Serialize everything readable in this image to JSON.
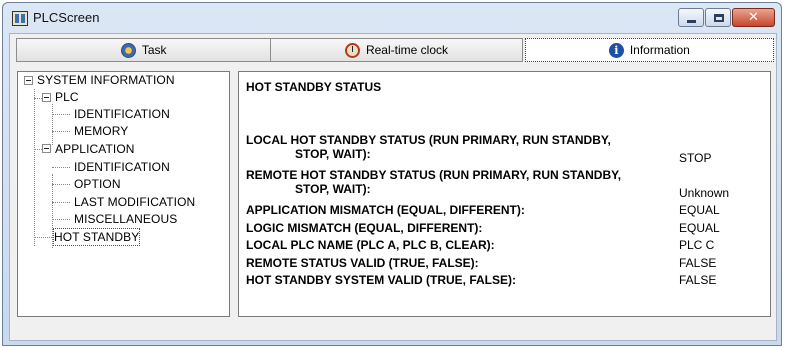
{
  "window": {
    "title": "PLCScreen",
    "close_glyph": "✕"
  },
  "tabs": [
    {
      "label": "Task",
      "icon": "task-icon"
    },
    {
      "label": "Real-time clock",
      "icon": "clock-icon"
    },
    {
      "label": "Information",
      "icon": "info-icon",
      "selected": true
    }
  ],
  "tree": {
    "root": "SYSTEM INFORMATION",
    "plc": "PLC",
    "plc_identification": "IDENTIFICATION",
    "plc_memory": "MEMORY",
    "application": "APPLICATION",
    "app_identification": "IDENTIFICATION",
    "app_option": "OPTION",
    "app_last_modification": "LAST MODIFICATION",
    "app_miscellaneous": "MISCELLANEOUS",
    "hot_standby": "HOT STANDBY"
  },
  "detail": {
    "heading": "HOT STANDBY STATUS",
    "rows": [
      {
        "label": "LOCAL HOT STANDBY STATUS (RUN PRIMARY, RUN STANDBY,",
        "cont": "STOP, WAIT):",
        "value": "STOP"
      },
      {
        "label": "REMOTE HOT STANDBY STATUS (RUN PRIMARY, RUN STANDBY,",
        "cont": "STOP, WAIT):",
        "value": "Unknown"
      },
      {
        "label": "APPLICATION MISMATCH (EQUAL, DIFFERENT):",
        "value": "EQUAL"
      },
      {
        "label": "LOGIC MISMATCH (EQUAL, DIFFERENT):",
        "value": "EQUAL"
      },
      {
        "label": "LOCAL PLC NAME (PLC A, PLC B, CLEAR):",
        "value": "PLC C"
      },
      {
        "label": "REMOTE STATUS VALID (TRUE, FALSE):",
        "value": "FALSE"
      },
      {
        "label": "HOT STANDBY SYSTEM VALID (TRUE, FALSE):",
        "value": "FALSE"
      }
    ]
  }
}
